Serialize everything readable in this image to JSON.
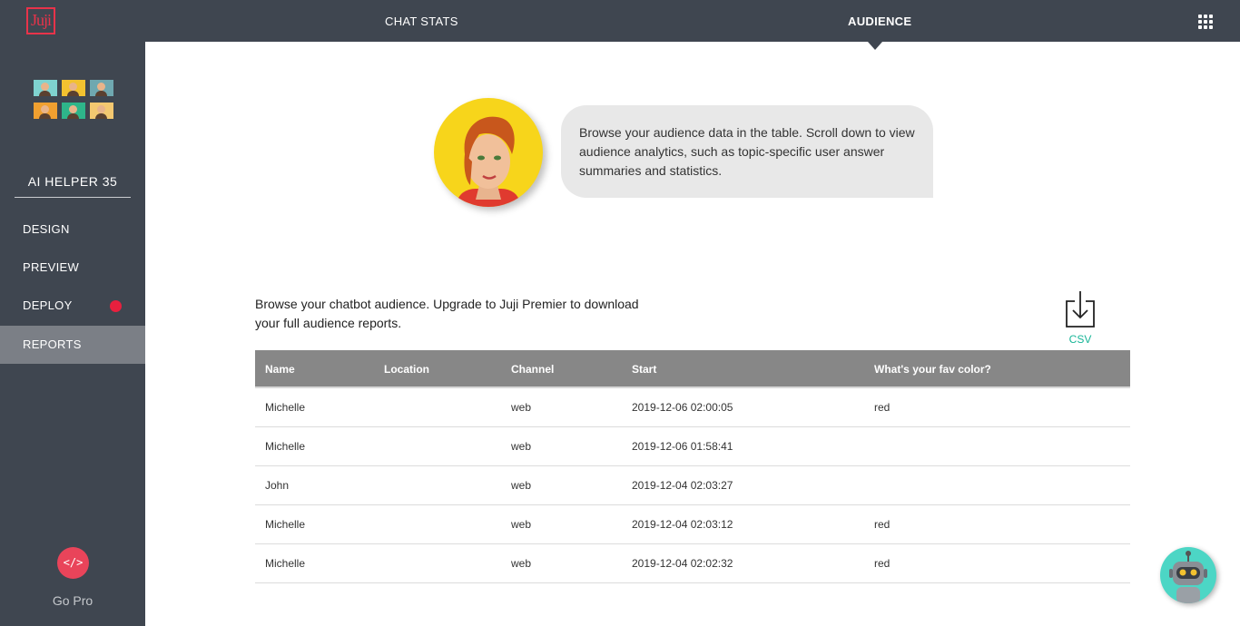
{
  "app": {
    "logo_text": "Juji"
  },
  "topnav": {
    "chat_stats": "CHAT STATS",
    "audience": "AUDIENCE"
  },
  "sidebar": {
    "bot_name": "AI HELPER 35",
    "items": [
      {
        "label": "DESIGN"
      },
      {
        "label": "PREVIEW"
      },
      {
        "label": "DEPLOY"
      },
      {
        "label": "REPORTS"
      }
    ],
    "gopro_icon": "</>",
    "gopro_label": "Go Pro"
  },
  "hero": {
    "message": "Browse your audience data in the table. Scroll down to view audience analytics, such as topic-specific user answer summaries and statistics."
  },
  "audience": {
    "intro": "Browse your chatbot audience. Upgrade to Juji Premier to download your full audience reports.",
    "csv_label": "CSV",
    "columns": [
      "Name",
      "Location",
      "Channel",
      "Start",
      "What's your fav color?"
    ],
    "rows": [
      [
        "Michelle",
        "",
        "web",
        "2019-12-06 02:00:05",
        "red"
      ],
      [
        "Michelle",
        "",
        "web",
        "2019-12-06 01:58:41",
        ""
      ],
      [
        "John",
        "",
        "web",
        "2019-12-04 02:03:27",
        ""
      ],
      [
        "Michelle",
        "",
        "web",
        "2019-12-04 02:03:12",
        "red"
      ],
      [
        "Michelle",
        "",
        "web",
        "2019-12-04 02:02:32",
        "red"
      ]
    ]
  },
  "colors": {
    "sidebar": "#3f4650",
    "accent_red": "#e8203e",
    "csv_green": "#17b597",
    "table_header": "#878787"
  }
}
